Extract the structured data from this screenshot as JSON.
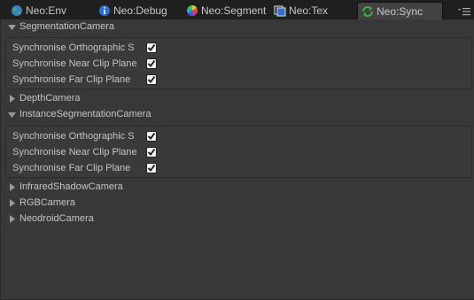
{
  "tabs": [
    {
      "label": "Neo:Env",
      "icon": "globe-icon",
      "active": false
    },
    {
      "label": "Neo:Debug",
      "icon": "info-icon",
      "active": false
    },
    {
      "label": "Neo:Segment",
      "icon": "color-wheel-icon",
      "active": false
    },
    {
      "label": "Neo:Tex",
      "icon": "texture-icon",
      "active": false
    },
    {
      "label": "Neo:Sync",
      "icon": "sync-icon",
      "active": true
    }
  ],
  "sections": [
    {
      "title": "SegmentationCamera",
      "expanded": true,
      "rows": [
        {
          "label": "Synchronise Orthographic S",
          "checked": true
        },
        {
          "label": "Synchronise Near Clip Plane",
          "checked": true
        },
        {
          "label": "Synchronise Far Clip Plane",
          "checked": true
        }
      ]
    },
    {
      "title": "DepthCamera",
      "expanded": false
    },
    {
      "title": "InstanceSegmentationCamera",
      "expanded": true,
      "rows": [
        {
          "label": "Synchronise Orthographic S",
          "checked": true
        },
        {
          "label": "Synchronise Near Clip Plane",
          "checked": true
        },
        {
          "label": "Synchronise Far Clip Plane",
          "checked": true
        }
      ]
    },
    {
      "title": "InfraredShadowCamera",
      "expanded": false
    },
    {
      "title": "RGBCamera",
      "expanded": false
    },
    {
      "title": "NeodroidCamera",
      "expanded": false
    }
  ]
}
